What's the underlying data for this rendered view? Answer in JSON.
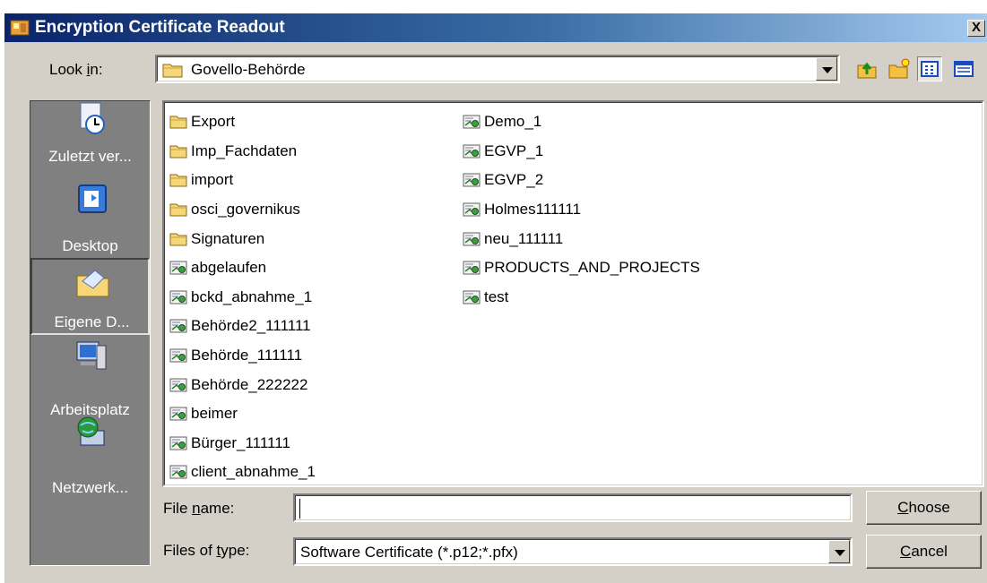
{
  "window": {
    "title": "Encryption Certificate Readout",
    "close_label": "X"
  },
  "lookin": {
    "label_prefix": "Look ",
    "label_accel": "i",
    "label_suffix": "n:",
    "value": "Govello-Behörde"
  },
  "toolbar": {
    "icons": [
      "up-folder-icon",
      "new-folder-icon",
      "list-view-icon",
      "details-view-icon"
    ]
  },
  "places": [
    {
      "label": "Zuletzt ver...",
      "icon": "recent-clock-icon"
    },
    {
      "label": "Desktop",
      "icon": "desktop-icon"
    },
    {
      "label": "Eigene D...",
      "icon": "my-documents-folder-icon"
    },
    {
      "label": "Arbeitsplatz",
      "icon": "computer-icon"
    },
    {
      "label": "Netzwerk...",
      "icon": "network-globe-icon"
    }
  ],
  "files": {
    "column1": [
      {
        "name": "Export",
        "type": "folder"
      },
      {
        "name": "Imp_Fachdaten",
        "type": "folder"
      },
      {
        "name": "import",
        "type": "folder"
      },
      {
        "name": "osci_governikus",
        "type": "folder"
      },
      {
        "name": "Signaturen",
        "type": "folder"
      },
      {
        "name": "abgelaufen",
        "type": "certificate"
      },
      {
        "name": "bckd_abnahme_1",
        "type": "certificate"
      },
      {
        "name": "Behörde2_111111",
        "type": "certificate"
      },
      {
        "name": "Behörde_111111",
        "type": "certificate"
      },
      {
        "name": "Behörde_222222",
        "type": "certificate"
      },
      {
        "name": "beimer",
        "type": "certificate"
      },
      {
        "name": "Bürger_111111",
        "type": "certificate"
      },
      {
        "name": "client_abnahme_1",
        "type": "certificate"
      }
    ],
    "column2": [
      {
        "name": "Demo_1",
        "type": "certificate"
      },
      {
        "name": "EGVP_1",
        "type": "certificate"
      },
      {
        "name": "EGVP_2",
        "type": "certificate"
      },
      {
        "name": "Holmes111111",
        "type": "certificate"
      },
      {
        "name": "neu_111111",
        "type": "certificate"
      },
      {
        "name": "PRODUCTS_AND_PROJECTS",
        "type": "certificate"
      },
      {
        "name": "test",
        "type": "certificate"
      }
    ]
  },
  "filename": {
    "label_prefix": "File ",
    "label_accel": "n",
    "label_suffix": "ame:",
    "value": ""
  },
  "filetype": {
    "label_prefix": "Files of ",
    "label_accel": "t",
    "label_suffix": "ype:",
    "value": "Software Certificate (*.p12;*.pfx)"
  },
  "buttons": {
    "choose": {
      "accel": "C",
      "rest": "hoose"
    },
    "cancel": {
      "accel": "C",
      "rest": "ancel"
    }
  }
}
